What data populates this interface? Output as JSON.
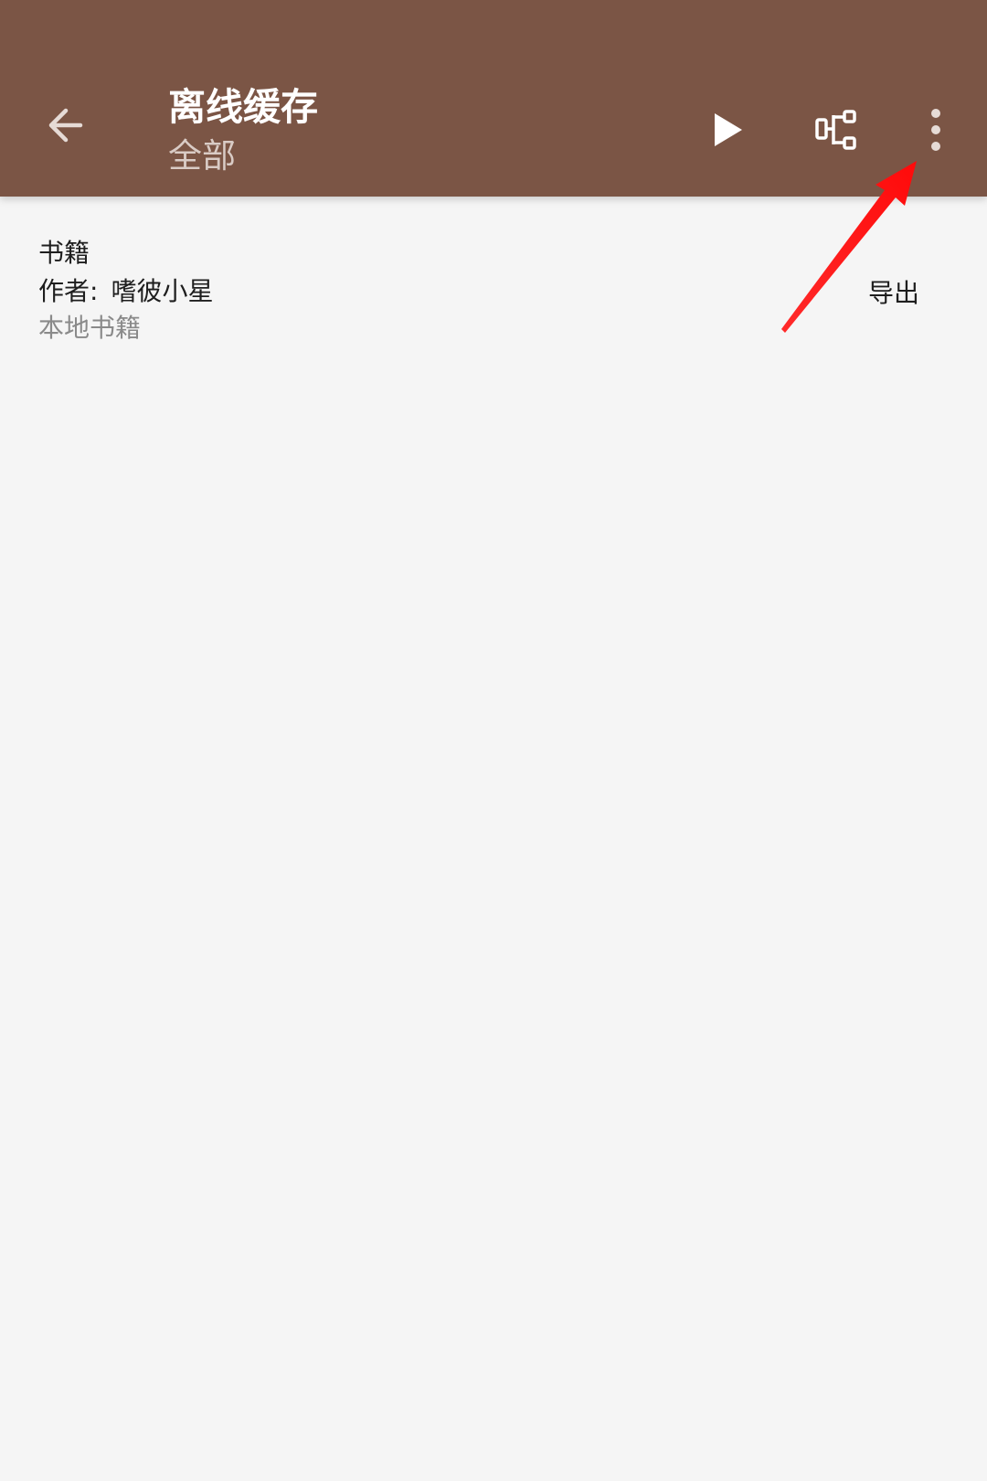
{
  "colors": {
    "toolbar_bg": "#7b5545",
    "page_bg": "#f5f5f5",
    "annotation_arrow": "#ff1a1a"
  },
  "toolbar": {
    "back_icon": "arrow-left-icon",
    "title": "离线缓存",
    "subtitle": "全部",
    "actions": [
      {
        "icon": "play-icon"
      },
      {
        "icon": "tree-structure-icon"
      },
      {
        "icon": "more-vertical-icon"
      }
    ]
  },
  "book": {
    "name": "书籍",
    "author_prefix": "作者:",
    "author": "嗜彼小星",
    "origin": "本地书籍",
    "export_label": "导出"
  }
}
